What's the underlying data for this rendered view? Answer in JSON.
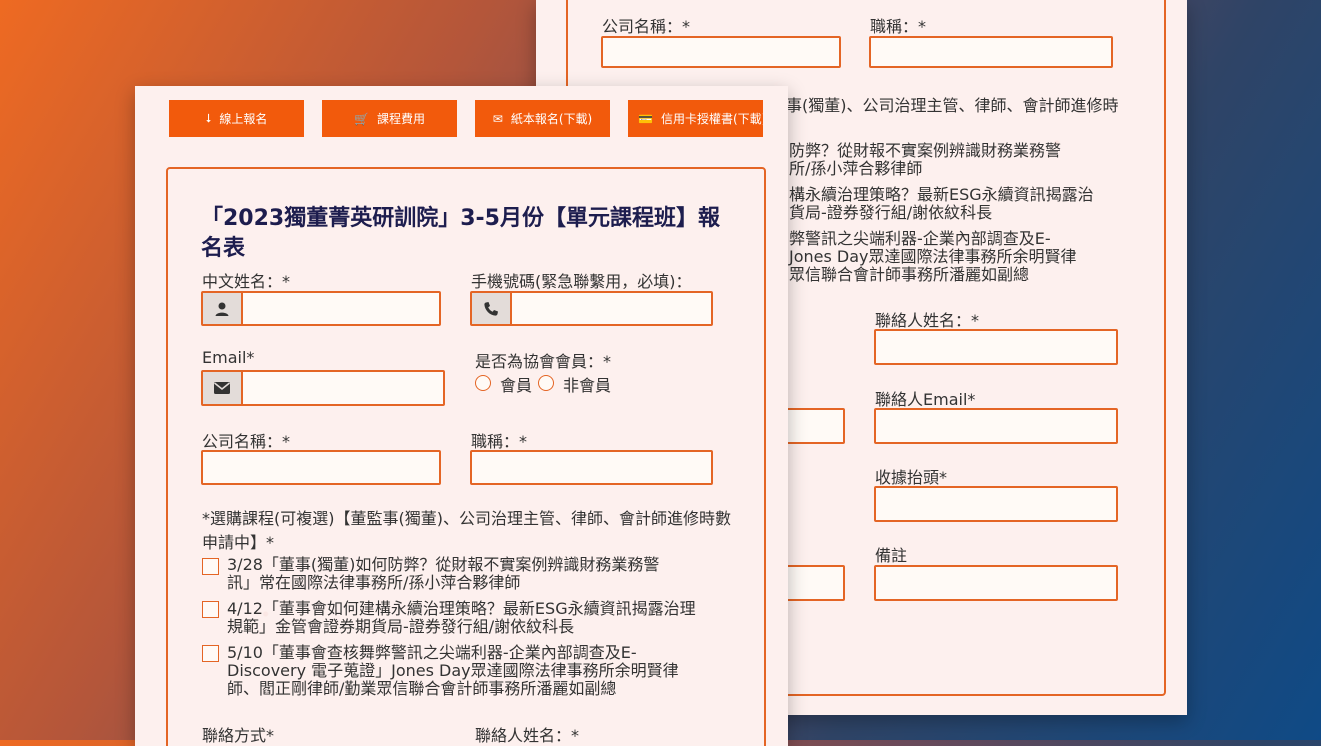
{
  "tabs": [
    {
      "icon": "arrow-down-icon",
      "glyph": "⭣",
      "label": "線上報名"
    },
    {
      "icon": "cart-icon",
      "glyph": "🛒",
      "label": "課程費用"
    },
    {
      "icon": "envelope-icon",
      "glyph": "✉",
      "label": "紙本報名(下載)"
    },
    {
      "icon": "credit-card-icon",
      "glyph": "💳",
      "label": "信用卡授權書(下載)"
    }
  ],
  "form": {
    "title": "「2023獨董菁英研訓院」3-5月份【單元課程班】報名表",
    "name_label": "中文姓名：*",
    "phone_label": "手機號碼(緊急聯繫用，必填)：",
    "email_label": "Email*",
    "member_label": "是否為協會會員：*",
    "member_opt1": "會員",
    "member_opt2": "非會員",
    "company_label": "公司名稱：*",
    "title_label": "職稱：*",
    "course_label": "*選購課程(可複選)【董監事(獨董)、公司治理主管、律師、會計師進修時數 申請中】*",
    "courses": [
      "3/28「董事(獨董)如何防弊？從財報不實案例辨識財務業務警訊」常在國際法律事務所/孫小萍合夥律師",
      "4/12「董事會如何建構永續治理策略？最新ESG永續資訊揭露治理規範」金管會證券期貨局-證券發行組/謝依紋科長",
      "5/10「董事會查核舞弊警訊之尖端利器-企業內部調查及E-Discovery 電子蒐證」Jones Day眾達國際法律事務所余明賢律師、閻正剛律師/勤業眾信聯合會計師事務所潘麗如副總"
    ],
    "contact_method_label": "聯絡方式*",
    "contact_name_label": "聯絡人姓名：*"
  },
  "back": {
    "company_label": "公司名稱：*",
    "title_label": "職稱：*",
    "course_snippet": "事(獨董)、公司治理主管、律師、會計師進修時",
    "c1a": "防弊？從財報不實案例辨識財務業務警",
    "c1b": "所/孫小萍合夥律師",
    "c2a": "構永續治理策略？最新ESG永續資訊揭露治",
    "c2b": "貨局-證券發行組/謝依紋科長",
    "c3a": "弊警訊之尖端利器-企業內部調查及E-",
    "c3b": "Jones Day眾達國際法律事務所余明賢律",
    "c3c": "眾信聯合會計師事務所潘麗如副總",
    "contact_name_label": "聯絡人姓名：*",
    "contact_email_label": "聯絡人Email*",
    "receipt_label": "收據抬頭*",
    "note_label": "備註"
  }
}
